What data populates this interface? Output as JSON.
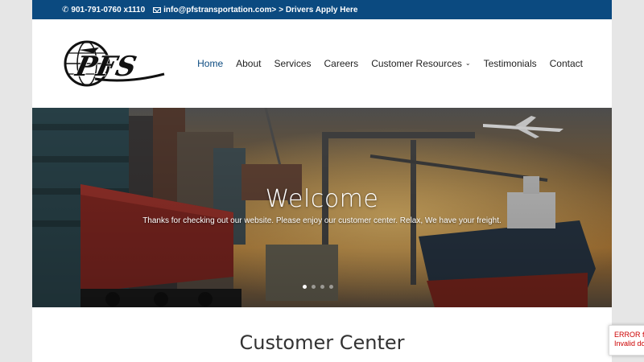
{
  "topbar": {
    "phone": "901-791-0760 x1110",
    "email": "info@pfstransportation.com>",
    "apply_link": "> Drivers Apply Here",
    "phone_icon": "phone-icon",
    "email_icon": "mail-icon"
  },
  "logo": {
    "text": "PFS",
    "alt": "PFS Transportation logo"
  },
  "nav": {
    "items": [
      {
        "label": "Home"
      },
      {
        "label": "About"
      },
      {
        "label": "Services"
      },
      {
        "label": "Careers"
      },
      {
        "label": "Customer Resources"
      },
      {
        "label": "Testimonials"
      },
      {
        "label": "Contact"
      }
    ],
    "dropdown_icon": "chevron-down-icon"
  },
  "hero": {
    "title": "Welcome",
    "subtitle": "Thanks for checking out our website. Please enjoy our customer center. Relax, We have your freight.",
    "slide_count": 4,
    "active_slide": 1
  },
  "section": {
    "title": "Customer Center"
  },
  "recaptcha": {
    "line1": "ERROR fo",
    "line2": "Invalid do"
  },
  "colors": {
    "topbar": "#0b4a80",
    "accent": "#0b4a80",
    "text": "#222222"
  }
}
